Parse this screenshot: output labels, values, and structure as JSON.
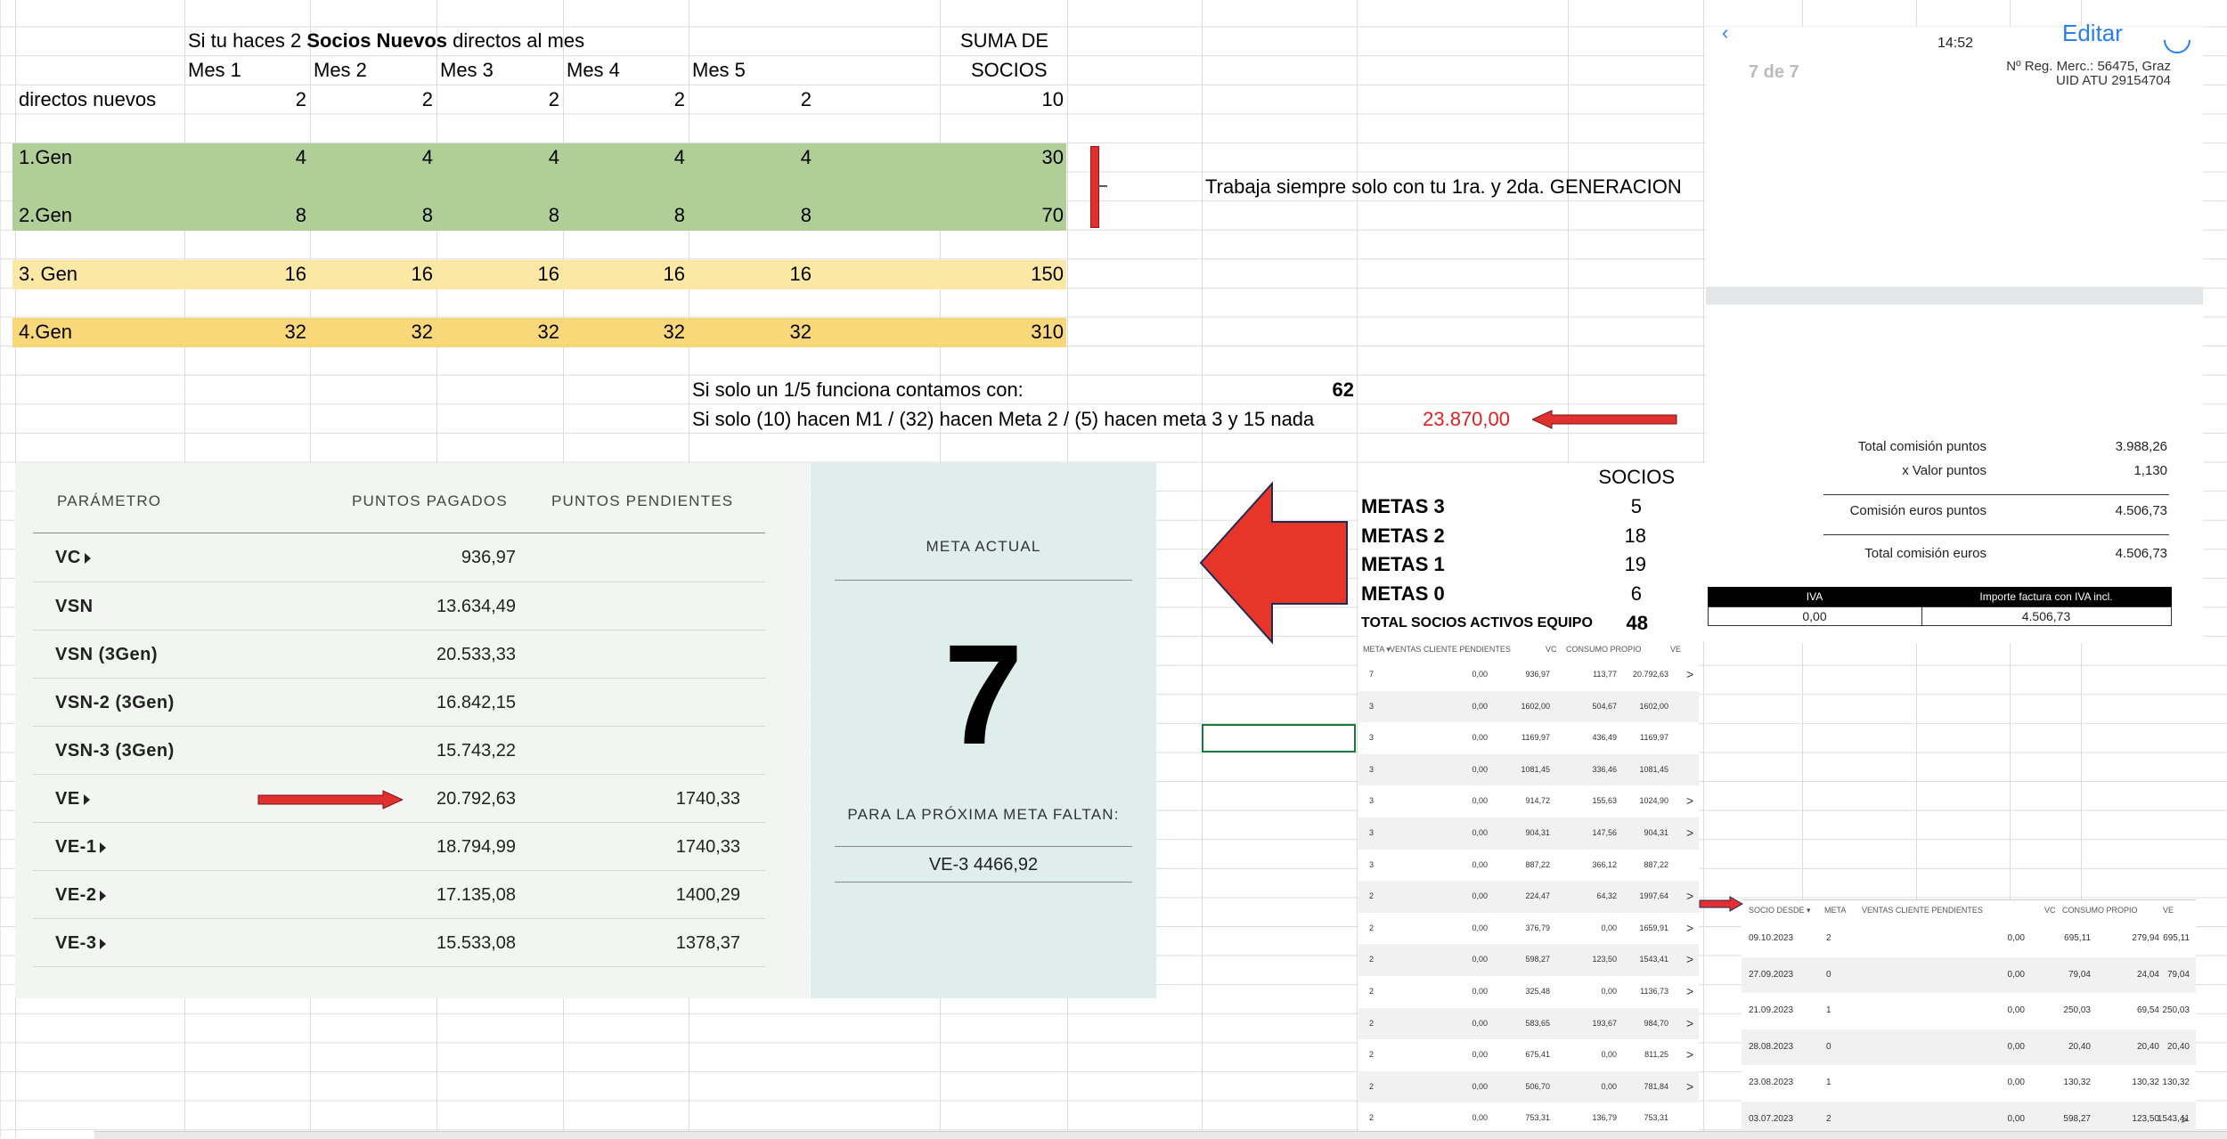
{
  "sheet": {
    "header_intro_pre": "Si tu haces 2 ",
    "header_intro_bold": "Socios Nuevos",
    "header_intro_post": " directos al mes",
    "suma_line1": "SUMA DE",
    "suma_line2": "SOCIOS",
    "months": [
      "Mes 1",
      "Mes 2",
      "Mes 3",
      "Mes 4",
      "Mes 5"
    ],
    "rows": [
      {
        "label": "directos nuevos",
        "values": [
          "2",
          "2",
          "2",
          "2",
          "2"
        ],
        "total": "10"
      },
      {
        "label": "1.Gen",
        "values": [
          "4",
          "4",
          "4",
          "4",
          "4"
        ],
        "total": "30"
      },
      {
        "label": "2.Gen",
        "values": [
          "8",
          "8",
          "8",
          "8",
          "8"
        ],
        "total": "70"
      },
      {
        "label": "3. Gen",
        "values": [
          "16",
          "16",
          "16",
          "16",
          "16"
        ],
        "total": "150"
      },
      {
        "label": "4.Gen",
        "values": [
          "32",
          "32",
          "32",
          "32",
          "32"
        ],
        "total": "310"
      }
    ],
    "note_generation": "Trabaja siempre  solo con tu 1ra. y  2da. GENERACION",
    "one_fifth_text": "Si solo un  1/5 funciona contamos con:",
    "one_fifth_value": "62",
    "scenario_text": "Si solo (10) hacen M1 / (32)  hacen Meta 2 / (5)  hacen meta 3 y 15 nada",
    "scenario_value": "23.870,00",
    "colors": {
      "green_band": "#b0cf96",
      "light_yellow": "#fbe8a4",
      "yellow": "#f9d87a",
      "red": "#e02020"
    }
  },
  "dashboard": {
    "col_param": "PARÁMETRO",
    "col_paid": "PUNTOS PAGADOS",
    "col_pending": "PUNTOS PENDIENTES",
    "rows": [
      {
        "label": "VC",
        "arrow": true,
        "paid": "936,97",
        "pending": ""
      },
      {
        "label": "VSN",
        "arrow": false,
        "paid": "13.634,49",
        "pending": ""
      },
      {
        "label": "VSN (3Gen)",
        "arrow": false,
        "paid": "20.533,33",
        "pending": ""
      },
      {
        "label": "VSN-2 (3Gen)",
        "arrow": false,
        "paid": "16.842,15",
        "pending": ""
      },
      {
        "label": "VSN-3 (3Gen)",
        "arrow": false,
        "paid": "15.743,22",
        "pending": ""
      },
      {
        "label": "VE",
        "arrow": true,
        "paid": "20.792,63",
        "pending": "1740,33"
      },
      {
        "label": "VE-1",
        "arrow": true,
        "paid": "18.794,99",
        "pending": "1740,33"
      },
      {
        "label": "VE-2",
        "arrow": true,
        "paid": "17.135,08",
        "pending": "1400,29"
      },
      {
        "label": "VE-3",
        "arrow": true,
        "paid": "15.533,08",
        "pending": "1378,37"
      }
    ],
    "meta_title": "META ACTUAL",
    "meta_value": "7",
    "next_meta_label": "PARA LA PRÓXIMA META FALTAN:",
    "next_meta_value": "VE-3 4466,92"
  },
  "metas": {
    "header": "SOCIOS",
    "rows": [
      {
        "label": "METAS 3",
        "value": "5"
      },
      {
        "label": "METAS 2",
        "value": "18"
      },
      {
        "label": "METAS 1",
        "value": "19"
      },
      {
        "label": "METAS 0",
        "value": "6"
      }
    ],
    "total_label": "TOTAL SOCIOS ACTIVOS EQUIPO",
    "total_value": "48"
  },
  "invoice": {
    "time": "14:52",
    "edit_label": "Editar",
    "page_indicator": "7 de 7",
    "reg_line1": "Nº Reg. Merc.: 56475, Graz",
    "reg_line2": "UID ATU 29154704",
    "lines": [
      {
        "label": "Total comisión puntos",
        "value": "3.988,26"
      },
      {
        "label": "x Valor puntos",
        "value": "1,130"
      },
      {
        "label": "Comisión euros puntos",
        "value": "4.506,73"
      },
      {
        "label": "Total comisión euros",
        "value": "4.506,73"
      }
    ],
    "iva_header": "IVA",
    "importe_header": "Importe factura con IVA incl.",
    "iva_value": "0,00",
    "importe_value": "4.506,73"
  },
  "meta_table": {
    "headers": [
      "META ▾",
      "VENTAS CLIENTE PENDIENTES",
      "VC",
      "CONSUMO PROPIO",
      "VE"
    ],
    "rows": [
      [
        "7",
        "0,00",
        "936,97",
        "113,77",
        "20.792,63",
        ">"
      ],
      [
        "3",
        "0,00",
        "1602,00",
        "504,67",
        "1602,00",
        ""
      ],
      [
        "3",
        "0,00",
        "1169,97",
        "436,49",
        "1169,97",
        ""
      ],
      [
        "3",
        "0,00",
        "1081,45",
        "336,46",
        "1081,45",
        ""
      ],
      [
        "3",
        "0,00",
        "914,72",
        "155,63",
        "1024,90",
        ">"
      ],
      [
        "3",
        "0,00",
        "904,31",
        "147,56",
        "904,31",
        ">"
      ],
      [
        "3",
        "0,00",
        "887,22",
        "366,12",
        "887,22",
        ""
      ],
      [
        "2",
        "0,00",
        "224,47",
        "64,32",
        "1997,64",
        ">"
      ],
      [
        "2",
        "0,00",
        "376,79",
        "0,00",
        "1659,91",
        ">"
      ],
      [
        "2",
        "0,00",
        "598,27",
        "123,50",
        "1543,41",
        ">"
      ],
      [
        "2",
        "0,00",
        "325,48",
        "0,00",
        "1136,73",
        ">"
      ],
      [
        "2",
        "0,00",
        "583,65",
        "193,67",
        "984,70",
        ">"
      ],
      [
        "2",
        "0,00",
        "675,41",
        "0,00",
        "811,25",
        ">"
      ],
      [
        "2",
        "0,00",
        "506,70",
        "0,00",
        "781,84",
        ">"
      ],
      [
        "2",
        "0,00",
        "753,31",
        "136,79",
        "753,31",
        ""
      ]
    ]
  },
  "socio_table": {
    "headers": [
      "SOCIO DESDE ▾",
      "META",
      "VENTAS CLIENTE PENDIENTES",
      "VC",
      "CONSUMO PROPIO",
      "VE"
    ],
    "rows": [
      [
        "09.10.2023",
        "2",
        "0,00",
        "695,11",
        "279,94",
        "695,11",
        ""
      ],
      [
        "27.09.2023",
        "0",
        "0,00",
        "79,04",
        "24,04",
        "79,04",
        ""
      ],
      [
        "21.09.2023",
        "1",
        "0,00",
        "250,03",
        "69,54",
        "250,03",
        ""
      ],
      [
        "28.08.2023",
        "0",
        "0,00",
        "20,40",
        "20,40",
        "20,40",
        ""
      ],
      [
        "23.08.2023",
        "1",
        "0,00",
        "130,32",
        "130,32",
        "130,32",
        ""
      ],
      [
        "03.07.2023",
        "2",
        "0,00",
        "598,27",
        "123,50",
        "1543,41",
        ">"
      ]
    ]
  }
}
